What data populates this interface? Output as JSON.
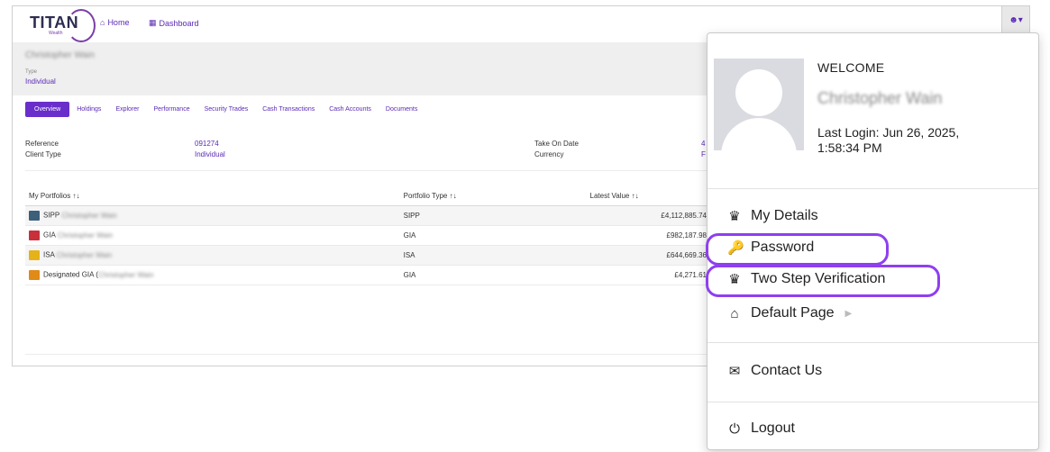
{
  "app": {
    "logo": {
      "name": "TITAN",
      "sub": "Wealth"
    },
    "nav": [
      {
        "icon": "home-icon",
        "label": "Home"
      },
      {
        "icon": "dashboard-icon",
        "label": "Dashboard"
      }
    ],
    "user_button": {
      "icon": "user-icon",
      "caret": "▾"
    }
  },
  "client": {
    "name": "Christopher Wain",
    "type_label": "Type",
    "type_value": "Individual"
  },
  "tabs": [
    {
      "label": "Overview",
      "active": true
    },
    {
      "label": "Holdings"
    },
    {
      "label": "Explorer"
    },
    {
      "label": "Performance"
    },
    {
      "label": "Security Trades"
    },
    {
      "label": "Cash Transactions"
    },
    {
      "label": "Cash Accounts"
    },
    {
      "label": "Documents"
    }
  ],
  "info": {
    "reference_label": "Reference",
    "reference_value": "091274",
    "client_type_label": "Client Type",
    "client_type_value": "Individual",
    "take_on_label": "Take On Date",
    "currency_label": "Currency",
    "take_on_value_partial": "4",
    "currency_value_partial": "F"
  },
  "table": {
    "headers": [
      "My Portfolios ↑↓",
      "Portfolio Type ↑↓",
      "Latest Value ↑↓"
    ],
    "rows": [
      {
        "color": "#3c5f7a",
        "name": "SIPP",
        "owner": "Christopher Wain",
        "type": "SIPP",
        "value": "£4,112,885.74"
      },
      {
        "color": "#c8303c",
        "name": "GIA",
        "owner": "Christopher Wain",
        "type": "GIA",
        "value": "£982,187.98"
      },
      {
        "color": "#e6b21a",
        "name": "ISA",
        "owner": "Christopher Wain",
        "type": "ISA",
        "value": "£644,669.36"
      },
      {
        "color": "#e08a18",
        "name": "Designated GIA (",
        "owner": "Christopher Wain",
        "type": "GIA",
        "value": "£4,271.61"
      }
    ]
  },
  "dropdown": {
    "welcome": "WELCOME",
    "user_name": "Christopher Wain",
    "last_login_line1": "Last Login: Jun 26, 2025,",
    "last_login_line2": "1:58:34 PM",
    "items": {
      "my_details": "My Details",
      "password": "Password",
      "two_step": "Two Step Verification",
      "default_page": "Default Page",
      "contact_us": "Contact Us",
      "logout": "Logout"
    },
    "highlight_color": "#8e3ff0"
  },
  "colors": {
    "accent": "#5b2ab5",
    "active_tab": "#6a2ecb"
  }
}
